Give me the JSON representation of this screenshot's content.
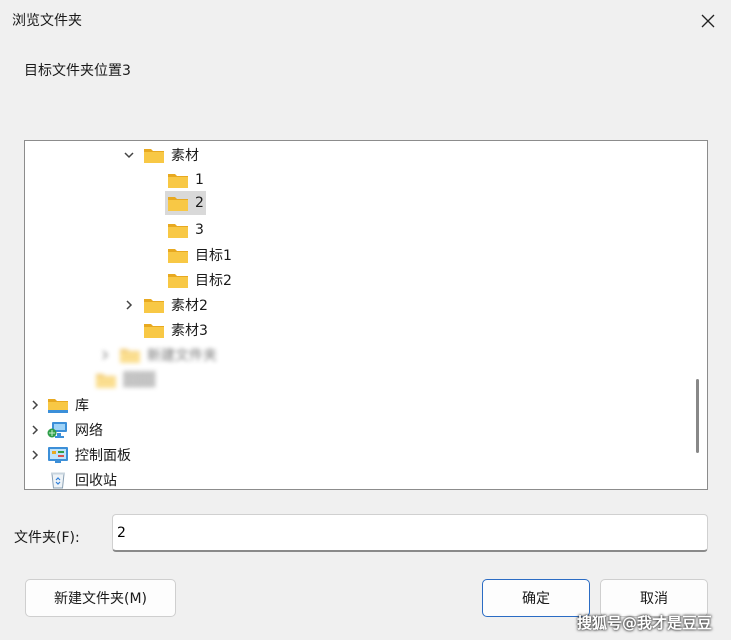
{
  "window": {
    "title": "浏览文件夹",
    "close_glyph": "✕"
  },
  "dialog": {
    "description": "目标文件夹位置3"
  },
  "tree": {
    "items": [
      {
        "label": "素材"
      },
      {
        "label": "1"
      },
      {
        "label": "2"
      },
      {
        "label": "3"
      },
      {
        "label": "目标1"
      },
      {
        "label": "目标2"
      },
      {
        "label": "素材2"
      },
      {
        "label": "素材3"
      },
      {
        "label": "新建文件夹"
      },
      {
        "label": "▓▓▓"
      },
      {
        "label": "库"
      },
      {
        "label": "网络"
      },
      {
        "label": "控制面板"
      },
      {
        "label": "回收站"
      }
    ],
    "selected_index": 2
  },
  "folder_field": {
    "label": "文件夹(F):",
    "value": "2"
  },
  "buttons": {
    "new_folder": "新建文件夹(M)",
    "ok": "确定",
    "cancel": "取消"
  },
  "watermark": "搜狐号@我才是豆豆",
  "colors": {
    "folder_yellow": "#f8c845",
    "folder_dark": "#e8a920",
    "accent": "#2b6cc4"
  }
}
